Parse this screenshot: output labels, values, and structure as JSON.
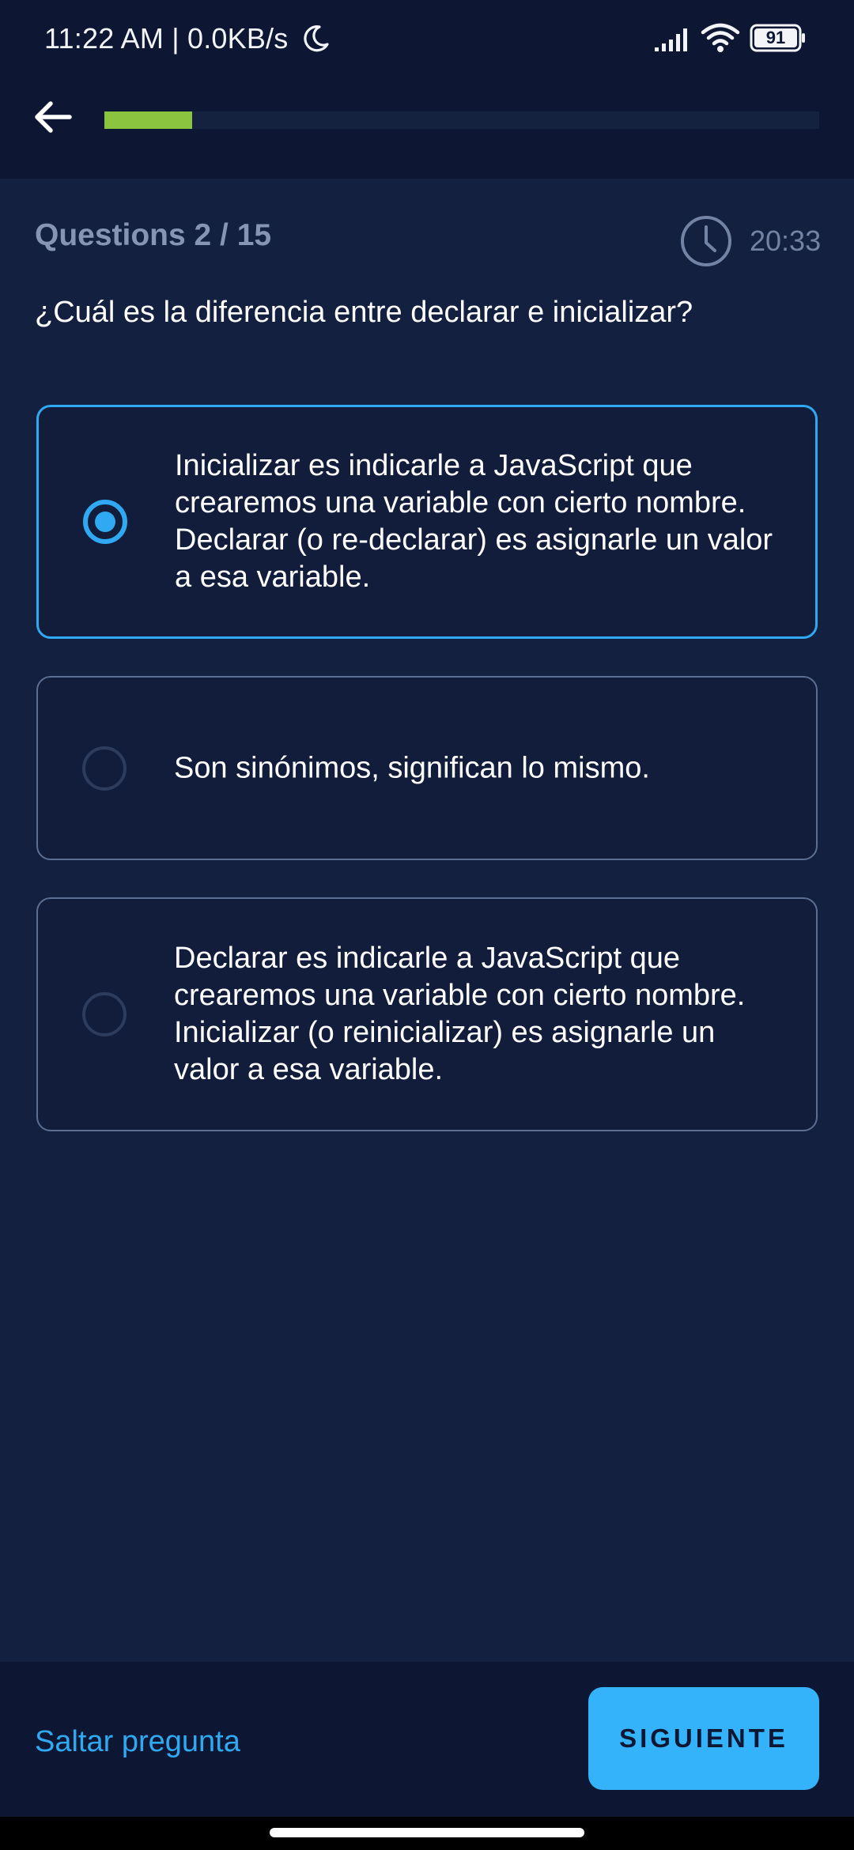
{
  "status_bar": {
    "time_network": "11:22 AM | 0.0KB/s",
    "battery": "91",
    "icons": [
      "moon-icon",
      "signal-icon",
      "wifi-icon",
      "battery-icon"
    ]
  },
  "header": {
    "back_icon": "arrow-left-icon",
    "progress_fraction": 0.123
  },
  "quiz": {
    "counter": "Questions 2 / 15",
    "timer_icon": "clock-icon",
    "timer": "20:33",
    "question": "¿Cuál es la diferencia entre declarar e inicializar?",
    "options": [
      {
        "label": "Inicializar es indicarle a JavaScript que crearemos una variable con cierto nombre. Declarar (o re-declarar) es asignarle un valor a esa variable.",
        "selected": true
      },
      {
        "label": "Son sinónimos, significan lo mismo.",
        "selected": false
      },
      {
        "label": "Declarar es indicarle a JavaScript que crearemos una variable con cierto nombre. Inicializar (o reinicializar) es asignarle un valor a esa variable.",
        "selected": false
      }
    ]
  },
  "footer": {
    "skip_label": "Saltar pregunta",
    "next_label": "SIGUIENTE"
  },
  "colors": {
    "background": "#13203f",
    "bar_background": "#0d1733",
    "accent_blue": "#2fa9f2",
    "button_blue": "#34b3fb",
    "progress_green": "#8bc540",
    "muted_text": "#8695b6"
  }
}
